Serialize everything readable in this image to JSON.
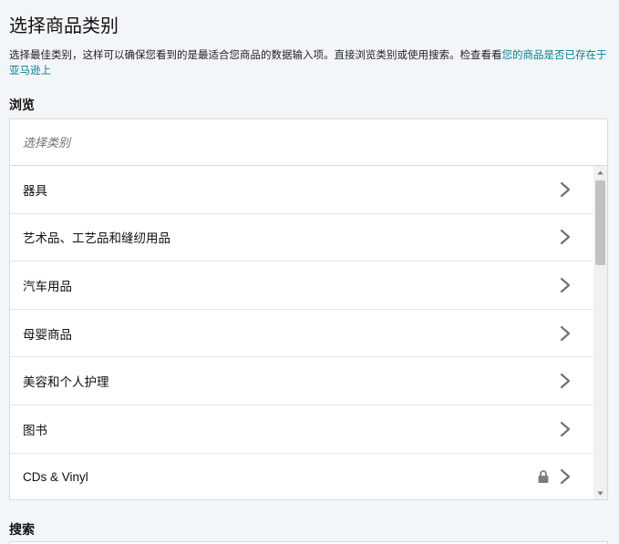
{
  "page": {
    "title": "选择商品类别",
    "intro_text": "选择最佳类别，这样可以确保您看到的是最适合您商品的数据输入项。直接浏览类别或使用搜索。检查看看",
    "intro_link": "您的商品是否已存在于亚马逊上"
  },
  "browse": {
    "label": "浏览",
    "input_placeholder": "选择类别",
    "categories": [
      {
        "label": "器具",
        "locked": false
      },
      {
        "label": "艺术品、工艺品和缝纫用品",
        "locked": false
      },
      {
        "label": "汽车用品",
        "locked": false
      },
      {
        "label": "母婴商品",
        "locked": false
      },
      {
        "label": "美容和个人护理",
        "locked": false
      },
      {
        "label": "图书",
        "locked": false
      },
      {
        "label": "CDs & Vinyl",
        "locked": true
      }
    ],
    "icons": {
      "chevron": "chevron-right-icon",
      "lock": "lock-icon"
    }
  },
  "search": {
    "label": "搜索"
  },
  "colors": {
    "link": "#008296",
    "chevron": "#6f7373",
    "border": "#d5d9d9"
  }
}
